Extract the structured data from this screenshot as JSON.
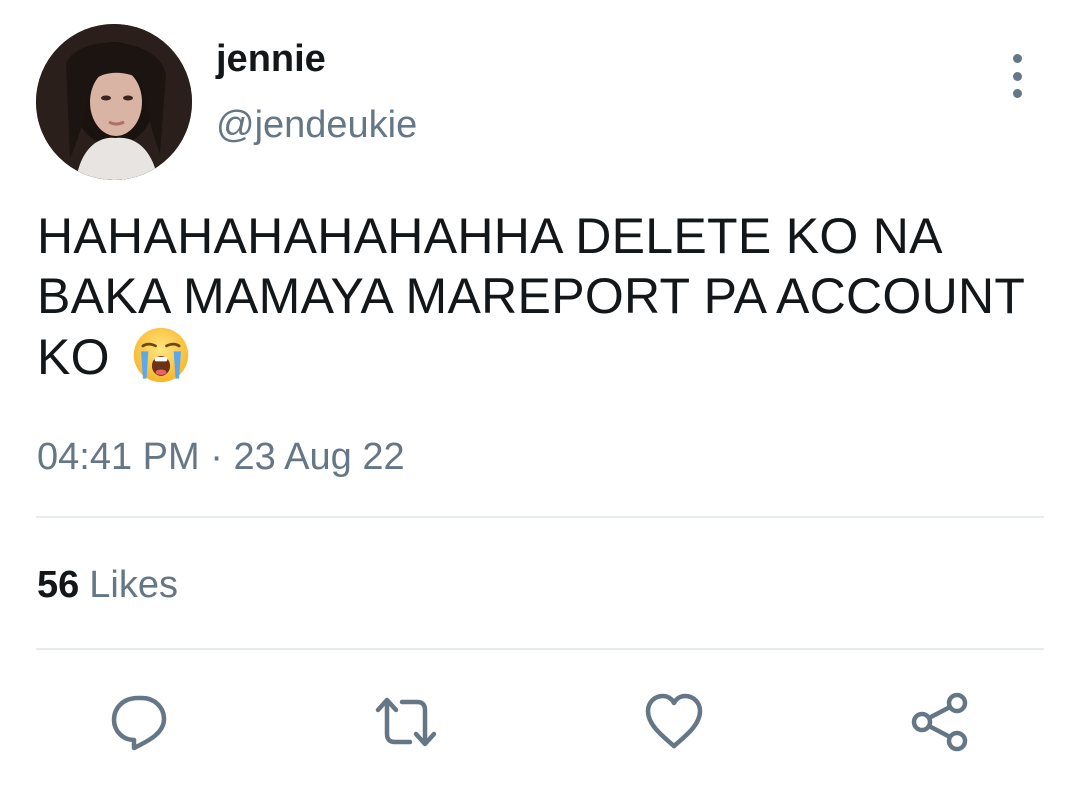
{
  "tweet": {
    "display_name": "jennie",
    "handle": "@jendeukie",
    "text": "HAHAHAHAHAHAHHA DELETE KO NA BAKA MAMAYA MAREPORT PA ACCOUNT KO",
    "emoji": "loudly-crying-face",
    "time": "04:41 PM",
    "separator": "·",
    "date": "23 Aug 22"
  },
  "stats": {
    "likes_count": "56",
    "likes_label": "Likes"
  },
  "actions": [
    {
      "name": "reply",
      "icon": "speech-bubble-icon"
    },
    {
      "name": "retweet",
      "icon": "retweet-icon"
    },
    {
      "name": "like",
      "icon": "heart-icon"
    },
    {
      "name": "share",
      "icon": "share-icon"
    }
  ],
  "colors": {
    "primary_text": "#14171a",
    "secondary_text": "#657786",
    "divider": "#e6ecf0"
  }
}
